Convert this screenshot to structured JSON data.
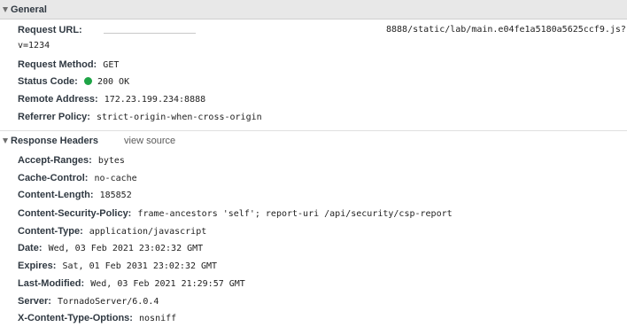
{
  "general": {
    "title": "General",
    "request_url_key": "Request URL:",
    "request_url_value": "8888/static/lab/main.e04fe1a5180a5625ccf9.js?",
    "request_url_cont": "v=1234",
    "request_method_key": "Request Method:",
    "request_method_value": "GET",
    "status_code_key": "Status Code:",
    "status_code_value": "200 OK",
    "status_color": "#1ea446",
    "remote_address_key": "Remote Address:",
    "remote_address_value": "172.23.199.234:8888",
    "referrer_policy_key": "Referrer Policy:",
    "referrer_policy_value": "strict-origin-when-cross-origin"
  },
  "response_headers": {
    "title": "Response Headers",
    "view_source_label": "view source",
    "items": [
      {
        "key": "Accept-Ranges:",
        "value": "bytes"
      },
      {
        "key": "Cache-Control:",
        "value": "no-cache"
      },
      {
        "key": "Content-Length:",
        "value": "185852"
      },
      {
        "key": "Content-Security-Policy:",
        "value": "frame-ancestors 'self'; report-uri /api/security/csp-report"
      },
      {
        "key": "Content-Type:",
        "value": "application/javascript"
      },
      {
        "key": "Date:",
        "value": "Wed, 03 Feb 2021 23:02:32 GMT"
      },
      {
        "key": "Expires:",
        "value": "Sat, 01 Feb 2031 23:02:32 GMT"
      },
      {
        "key": "Last-Modified:",
        "value": "Wed, 03 Feb 2021 21:29:57 GMT"
      },
      {
        "key": "Server:",
        "value": "TornadoServer/6.0.4"
      },
      {
        "key": "X-Content-Type-Options:",
        "value": "nosniff"
      }
    ]
  }
}
